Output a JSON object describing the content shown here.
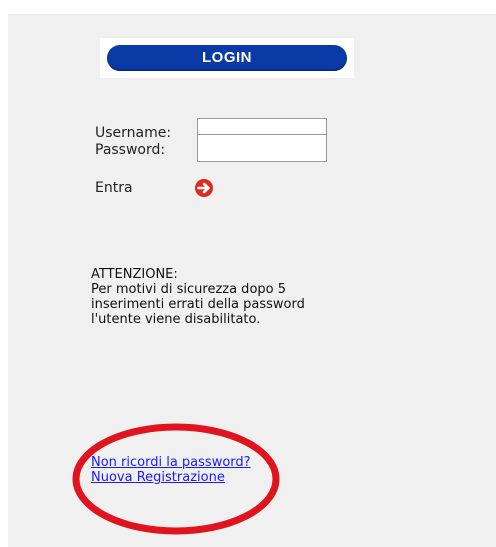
{
  "login_box": {
    "header": "LOGIN",
    "username_label": "Username:",
    "username_value": "",
    "password_label": "Password:",
    "password_value": "",
    "enter_label": "Entra",
    "enter_icon": "arrow-right-circle-icon"
  },
  "notice": {
    "title": "ATTENZIONE:",
    "lines": [
      "Per motivi di sicurezza dopo 5",
      "inserimenti errati della password",
      "l'utente viene disabilitato."
    ]
  },
  "links": {
    "forgot_password": "Non ricordi la password?",
    "new_registration": "Nuova Registrazione"
  },
  "colors": {
    "login_pill": "#0a3aa6",
    "enter_icon": "#e0281e",
    "link": "#1a1aff",
    "annotation_circle": "#e0141e"
  }
}
